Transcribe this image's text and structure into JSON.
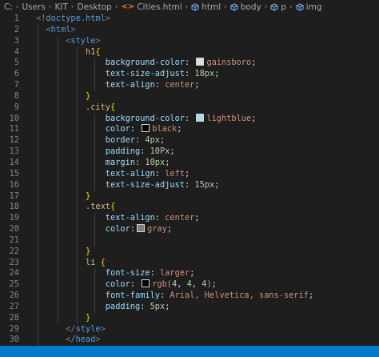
{
  "breadcrumb": {
    "items": [
      "C:",
      "Users",
      "KIT",
      "Desktop",
      "Cities.html",
      "html",
      "body",
      "p",
      "img"
    ],
    "file_glyph": "<>"
  },
  "colors": {
    "gainsboro": "#dcdcdc",
    "lightblue": "#add8e6",
    "black": "#000000",
    "gray": "#808080",
    "rgb_4_4_4": "#040404",
    "statusbar": "#007acc"
  },
  "lines": [
    {
      "n": "1",
      "tokens": [
        [
          "tag-b",
          "<"
        ],
        [
          "tag",
          "!doctype.html"
        ],
        [
          "tag-b",
          ">"
        ]
      ]
    },
    {
      "n": "2",
      "tokens": [
        [
          "tag-b",
          "<"
        ],
        [
          "tag",
          "html"
        ],
        [
          "tag-b",
          ">"
        ]
      ]
    },
    {
      "n": "3",
      "tokens": [
        [
          "tag-b",
          "<"
        ],
        [
          "tag",
          "style"
        ],
        [
          "tag-b",
          ">"
        ]
      ]
    },
    {
      "n": "4",
      "tokens": [
        [
          "sel",
          "h1"
        ],
        [
          "brace",
          "{"
        ]
      ]
    },
    {
      "n": "5",
      "tokens": [
        [
          "prop",
          "background-color"
        ],
        [
          "punc",
          ": "
        ],
        [
          "swatch",
          "gainsboro"
        ],
        [
          "val",
          "gainsboro"
        ],
        [
          "punc",
          ";"
        ]
      ]
    },
    {
      "n": "6",
      "tokens": [
        [
          "prop",
          "text-size-adjust"
        ],
        [
          "punc",
          ": "
        ],
        [
          "num",
          "18px"
        ],
        [
          "punc",
          ";"
        ]
      ]
    },
    {
      "n": "7",
      "tokens": [
        [
          "prop",
          "text-align"
        ],
        [
          "punc",
          ": "
        ],
        [
          "val",
          "center"
        ],
        [
          "punc",
          ";"
        ]
      ]
    },
    {
      "n": "8",
      "tokens": [
        [
          "brace",
          "}"
        ]
      ]
    },
    {
      "n": "9",
      "tokens": [
        [
          "sel",
          ".city"
        ],
        [
          "brace",
          "{"
        ]
      ]
    },
    {
      "n": "10",
      "tokens": [
        [
          "prop",
          "background-color"
        ],
        [
          "punc",
          ": "
        ],
        [
          "swatch",
          "lightblue"
        ],
        [
          "val",
          "lightblue"
        ],
        [
          "punc",
          ";"
        ]
      ]
    },
    {
      "n": "11",
      "tokens": [
        [
          "prop",
          "color"
        ],
        [
          "punc",
          ": "
        ],
        [
          "swatch",
          "black"
        ],
        [
          "val",
          "black"
        ],
        [
          "punc",
          ";"
        ]
      ]
    },
    {
      "n": "12",
      "tokens": [
        [
          "prop",
          "border"
        ],
        [
          "punc",
          ": "
        ],
        [
          "num",
          "4px"
        ],
        [
          "punc",
          ";"
        ]
      ]
    },
    {
      "n": "13",
      "tokens": [
        [
          "prop",
          "padding"
        ],
        [
          "punc",
          ": "
        ],
        [
          "num",
          "10Px"
        ],
        [
          "punc",
          ";"
        ]
      ]
    },
    {
      "n": "14",
      "tokens": [
        [
          "prop",
          "margin"
        ],
        [
          "punc",
          ": "
        ],
        [
          "num",
          "10px"
        ],
        [
          "punc",
          ";"
        ]
      ]
    },
    {
      "n": "15",
      "tokens": [
        [
          "prop",
          "text-align"
        ],
        [
          "punc",
          ": "
        ],
        [
          "val",
          "left"
        ],
        [
          "punc",
          ";"
        ]
      ]
    },
    {
      "n": "16",
      "tokens": [
        [
          "prop",
          "text-size-adjust"
        ],
        [
          "punc",
          ": "
        ],
        [
          "num",
          "15px"
        ],
        [
          "punc",
          ";"
        ]
      ]
    },
    {
      "n": "17",
      "tokens": [
        [
          "brace",
          "}"
        ]
      ]
    },
    {
      "n": "18",
      "tokens": [
        [
          "sel",
          ".text"
        ],
        [
          "brace",
          "{"
        ]
      ]
    },
    {
      "n": "19",
      "tokens": [
        [
          "prop",
          "text-align"
        ],
        [
          "punc",
          ": "
        ],
        [
          "val",
          "center"
        ],
        [
          "punc",
          ";"
        ]
      ]
    },
    {
      "n": "20",
      "tokens": [
        [
          "prop",
          "color"
        ],
        [
          "punc",
          ":"
        ],
        [
          "swatch",
          "gray"
        ],
        [
          "val",
          "gray"
        ],
        [
          "punc",
          ";"
        ]
      ]
    },
    {
      "n": "21",
      "tokens": []
    },
    {
      "n": "22",
      "tokens": [
        [
          "brace",
          "}"
        ]
      ]
    },
    {
      "n": "23",
      "tokens": [
        [
          "sel",
          "li "
        ],
        [
          "brace",
          "{"
        ]
      ]
    },
    {
      "n": "24",
      "tokens": [
        [
          "prop",
          "font-size"
        ],
        [
          "punc",
          ": "
        ],
        [
          "val",
          "larger"
        ],
        [
          "punc",
          ";"
        ]
      ]
    },
    {
      "n": "25",
      "tokens": [
        [
          "prop",
          "color"
        ],
        [
          "punc",
          ": "
        ],
        [
          "swatch",
          "rgb_4_4_4"
        ],
        [
          "val",
          "rgb("
        ],
        [
          "num",
          "4"
        ],
        [
          "punc",
          ", "
        ],
        [
          "num",
          "4"
        ],
        [
          "punc",
          ", "
        ],
        [
          "num",
          "4"
        ],
        [
          "val",
          ")"
        ],
        [
          "punc",
          ";"
        ]
      ]
    },
    {
      "n": "26",
      "tokens": [
        [
          "prop",
          "font-family"
        ],
        [
          "punc",
          ": "
        ],
        [
          "val",
          "Arial, Helvetica, sans-serif"
        ],
        [
          "punc",
          ";"
        ]
      ]
    },
    {
      "n": "27",
      "tokens": [
        [
          "prop",
          "padding"
        ],
        [
          "punc",
          ": "
        ],
        [
          "num",
          "5px"
        ],
        [
          "punc",
          ";"
        ]
      ]
    },
    {
      "n": "28",
      "tokens": [
        [
          "brace",
          "}"
        ]
      ]
    },
    {
      "n": "29",
      "tokens": [
        [
          "tag-b",
          "</"
        ],
        [
          "tag",
          "style"
        ],
        [
          "tag-b",
          ">"
        ]
      ]
    },
    {
      "n": "30",
      "tokens": [
        [
          "tag-b",
          "<"
        ],
        [
          "tag",
          "/head"
        ],
        [
          "tag-b",
          ">"
        ]
      ]
    }
  ]
}
